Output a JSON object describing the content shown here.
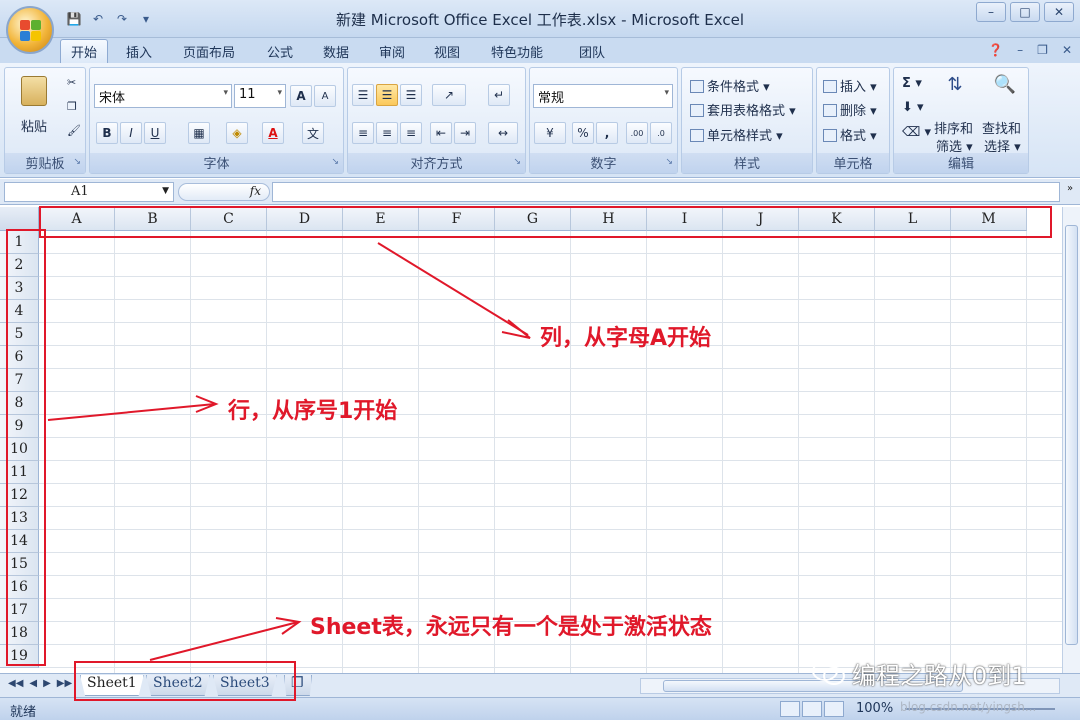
{
  "window": {
    "title": "新建 Microsoft Office Excel 工作表.xlsx - Microsoft Excel"
  },
  "tabs": [
    "开始",
    "插入",
    "页面布局",
    "公式",
    "数据",
    "审阅",
    "视图",
    "特色功能",
    "团队"
  ],
  "ribbon": {
    "clipboard": {
      "paste": "粘贴",
      "label": "剪贴板"
    },
    "font": {
      "name": "宋体",
      "size": "11",
      "label": "字体",
      "bold": "B",
      "italic": "I",
      "underline": "U",
      "grow": "A",
      "shrink": "A",
      "color": "A"
    },
    "alignment": {
      "label": "对齐方式"
    },
    "number": {
      "format": "常规",
      "label": "数字",
      "percent": "%",
      "comma": ","
    },
    "styles": {
      "conditional": "条件格式",
      "table": "套用表格格式",
      "cell": "单元格样式",
      "label": "样式"
    },
    "cells": {
      "insert": "插入",
      "delete": "删除",
      "format": "格式",
      "label": "单元格"
    },
    "editing": {
      "sort": "排序和",
      "sort2": "筛选",
      "find": "查找和",
      "find2": "选择",
      "label": "编辑",
      "sigma": "Σ"
    }
  },
  "formula_bar": {
    "name_box": "A1",
    "fx": "fx",
    "value": ""
  },
  "columns": [
    "A",
    "B",
    "C",
    "D",
    "E",
    "F",
    "G",
    "H",
    "I",
    "J",
    "K",
    "L",
    "M"
  ],
  "rows": [
    "1",
    "2",
    "3",
    "4",
    "5",
    "6",
    "7",
    "8",
    "9",
    "10",
    "11",
    "12",
    "13",
    "14",
    "15",
    "16",
    "17",
    "18",
    "19"
  ],
  "sheets": [
    "Sheet1",
    "Sheet2",
    "Sheet3"
  ],
  "status": {
    "ready": "就绪",
    "zoom": "100%"
  },
  "annotations": {
    "columns": "列，从字母A开始",
    "rows": "行，从序号1开始",
    "sheets": "Sheet表，永远只有一个是处于激活状态"
  },
  "watermark": {
    "text": "编程之路从0到1",
    "url": "blog.csdn.net/yingsh..."
  },
  "colors": {
    "annotation": "#e0182a",
    "ribbon": "#d6e4f5"
  }
}
